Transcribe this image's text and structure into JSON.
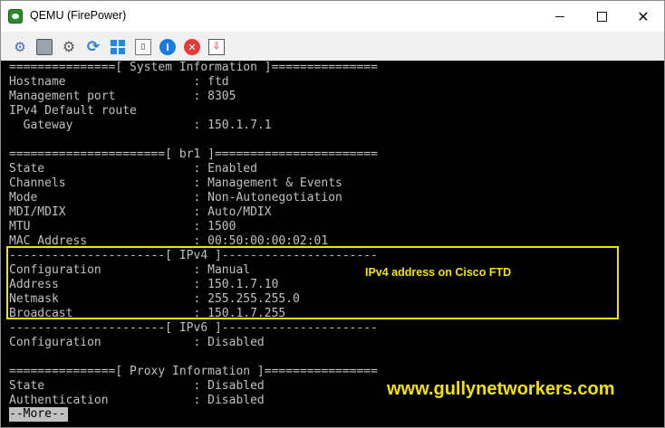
{
  "window": {
    "title": "QEMU (FirePower)",
    "minimize_glyph": "",
    "close_glyph": "✕"
  },
  "toolbar": {
    "icons": [
      "network-icon",
      "monitor-icon",
      "gear-icon",
      "refresh-icon",
      "windows-icon",
      "usb-icon",
      "info-icon",
      "stop-icon",
      "screenshot-icon"
    ],
    "search_value": "",
    "colors": {
      "flag_left": "#1a5e1a",
      "flag_mid": "#ffffff",
      "flag_right": "#b01010"
    }
  },
  "console": {
    "lines": [
      "===============[ System Information ]===============",
      "Hostname                  : ftd",
      "Management port           : 8305",
      "IPv4 Default route",
      "  Gateway                 : 150.1.7.1",
      "",
      "======================[ br1 ]=======================",
      "State                     : Enabled",
      "Channels                  : Management & Events",
      "Mode                      : Non-Autonegotiation",
      "MDI/MDIX                  : Auto/MDIX",
      "MTU                       : 1500",
      "MAC Address               : 00:50:00:00:02:01",
      "----------------------[ IPv4 ]----------------------",
      "Configuration             : Manual",
      "Address                   : 150.1.7.10",
      "Netmask                   : 255.255.255.0",
      "Broadcast                 : 150.1.7.255",
      "----------------------[ IPv6 ]----------------------",
      "Configuration             : Disabled",
      "",
      "===============[ Proxy Information ]================",
      "State                     : Disabled",
      "Authentication            : Disabled"
    ],
    "more_prompt": "--More--",
    "colors": {
      "text": "#c0c0c0",
      "background": "#000000",
      "highlight": "#f2e205"
    }
  },
  "annotation": {
    "text": "IPv4 address on Cisco FTD"
  },
  "watermark": {
    "text": "www.gullynetworkers.com"
  }
}
